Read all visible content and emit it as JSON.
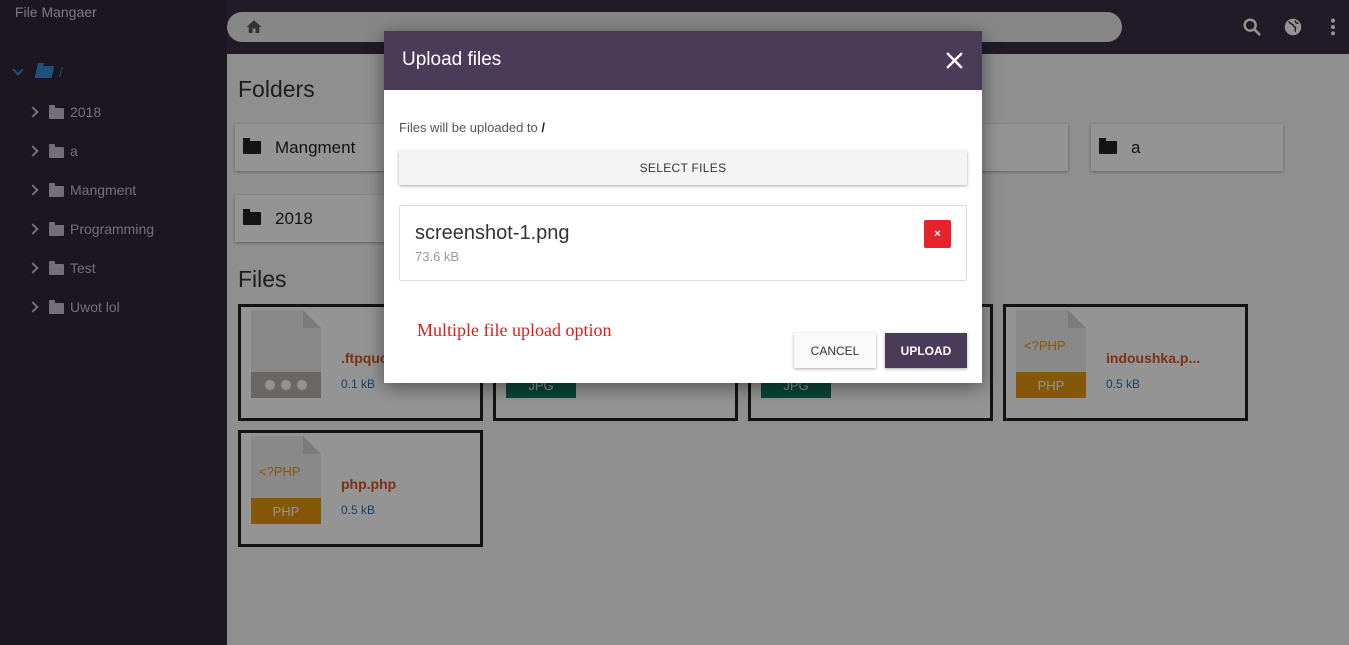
{
  "app": {
    "title": "File Mangaer"
  },
  "sidebar": {
    "root_label": "/",
    "items": [
      {
        "label": "2018"
      },
      {
        "label": "a"
      },
      {
        "label": "Mangment"
      },
      {
        "label": "Programming"
      },
      {
        "label": "Test"
      },
      {
        "label": "Uwot lol"
      }
    ]
  },
  "topbar": {
    "icons": [
      "home-icon",
      "search-icon",
      "globe-icon",
      "more-vert-icon"
    ]
  },
  "main": {
    "folders_title": "Folders",
    "files_title": "Files",
    "folders": [
      {
        "label": "Mangment"
      },
      {
        "label": "a"
      },
      {
        "label": "2018"
      }
    ],
    "files": [
      {
        "name": ".ftpquo",
        "size": "0.1 kB",
        "type": "generic",
        "color": "#b5b0b0"
      },
      {
        "name": "",
        "size": "",
        "type": "jpg",
        "badge": "JPG",
        "color": "#127a5f"
      },
      {
        "name": "",
        "size": "",
        "type": "jpg",
        "badge": "JPG",
        "color": "#127a5f"
      },
      {
        "name": "indoushka.p...",
        "size": "0.5 kB",
        "type": "php",
        "badge": "PHP",
        "code": "<?PHP",
        "color": "#e6960f"
      },
      {
        "name": "php.php",
        "size": "0.5 kB",
        "type": "php",
        "badge": "PHP",
        "code": "<?PHP",
        "color": "#e6960f"
      }
    ]
  },
  "modal": {
    "title": "Upload files",
    "upload_to_label": "Files will be uploaded to",
    "upload_to_path": "/",
    "select_button": "SELECT FILES",
    "selected_file": {
      "name": "screenshot-1.png",
      "size": "73.6 kB",
      "remove_label": "×"
    },
    "annotation": "Multiple file upload option",
    "cancel_button": "CANCEL",
    "upload_button": "UPLOAD"
  },
  "colors": {
    "sidebar_bg": "#2f2636",
    "topbar_bg": "#3a2f44",
    "modal_header_bg": "#4a3b58",
    "accent_blue": "#2f8fd6",
    "remove_red": "#e5232a",
    "annotation_red": "#e01a1a"
  }
}
